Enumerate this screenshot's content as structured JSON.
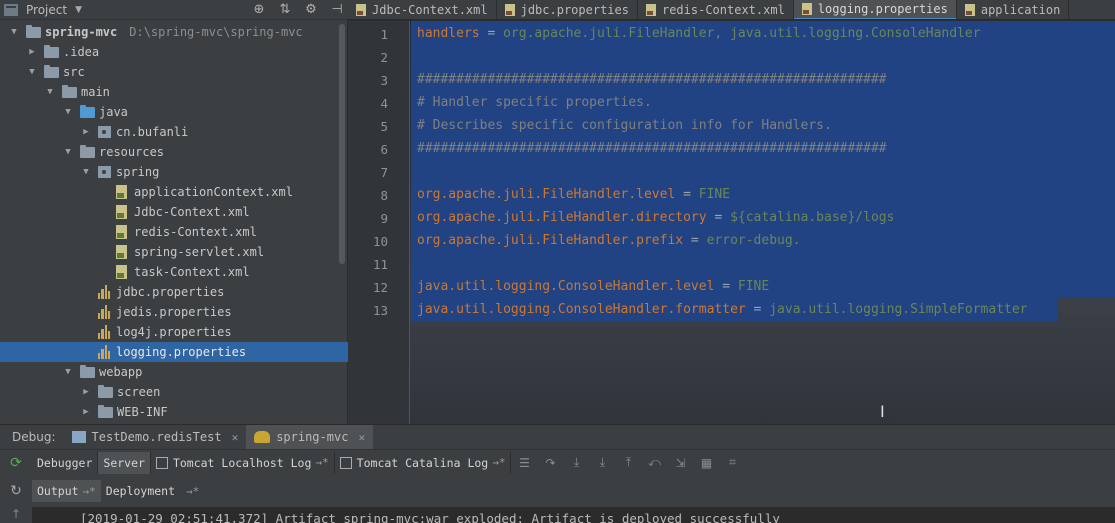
{
  "project_panel": {
    "title": "Project",
    "tree": [
      {
        "label": "spring-mvc",
        "path": "D:\\spring-mvc\\spring-mvc",
        "type": "module",
        "depth": 0,
        "expanded": true
      },
      {
        "label": ".idea",
        "type": "folder",
        "depth": 1,
        "expanded": false
      },
      {
        "label": "src",
        "type": "folder",
        "depth": 1,
        "expanded": true
      },
      {
        "label": "main",
        "type": "folder",
        "depth": 2,
        "expanded": true
      },
      {
        "label": "java",
        "type": "source-folder",
        "depth": 3,
        "expanded": true
      },
      {
        "label": "cn.bufanli",
        "type": "package",
        "depth": 4,
        "expanded": false
      },
      {
        "label": "resources",
        "type": "resource-folder",
        "depth": 3,
        "expanded": true
      },
      {
        "label": "spring",
        "type": "package",
        "depth": 4,
        "expanded": true
      },
      {
        "label": "applicationContext.xml",
        "type": "xml",
        "depth": 5
      },
      {
        "label": "Jdbc-Context.xml",
        "type": "xml",
        "depth": 5
      },
      {
        "label": "redis-Context.xml",
        "type": "xml",
        "depth": 5
      },
      {
        "label": "spring-servlet.xml",
        "type": "xml",
        "depth": 5
      },
      {
        "label": "task-Context.xml",
        "type": "xml",
        "depth": 5
      },
      {
        "label": "jdbc.properties",
        "type": "properties",
        "depth": 4
      },
      {
        "label": "jedis.properties",
        "type": "properties",
        "depth": 4
      },
      {
        "label": "log4j.properties",
        "type": "properties",
        "depth": 4
      },
      {
        "label": "logging.properties",
        "type": "properties",
        "depth": 4,
        "selected": true
      },
      {
        "label": "webapp",
        "type": "folder",
        "depth": 3,
        "expanded": true
      },
      {
        "label": "screen",
        "type": "folder",
        "depth": 4,
        "expanded": false
      },
      {
        "label": "WEB-INF",
        "type": "folder",
        "depth": 4,
        "expanded": false
      }
    ]
  },
  "editor_tabs": [
    {
      "label": "Jdbc-Context.xml",
      "active": false
    },
    {
      "label": "jdbc.properties",
      "active": false
    },
    {
      "label": "redis-Context.xml",
      "active": false
    },
    {
      "label": "logging.properties",
      "active": true
    },
    {
      "label": "application",
      "active": false
    }
  ],
  "editor": {
    "lines": [
      {
        "n": "1",
        "key": "handlers",
        "eq": " = ",
        "val": "org.apache.juli.FileHandler, java.util.logging.ConsoleHandler",
        "comment": ""
      },
      {
        "n": "2",
        "key": "",
        "eq": "",
        "val": "",
        "comment": ""
      },
      {
        "n": "3",
        "key": "",
        "eq": "",
        "val": "",
        "comment": "############################################################"
      },
      {
        "n": "4",
        "key": "",
        "eq": "",
        "val": "",
        "comment": "# Handler specific properties."
      },
      {
        "n": "5",
        "key": "",
        "eq": "",
        "val": "",
        "comment": "# Describes specific configuration info for Handlers."
      },
      {
        "n": "6",
        "key": "",
        "eq": "",
        "val": "",
        "comment": "############################################################"
      },
      {
        "n": "7",
        "key": "",
        "eq": "",
        "val": "",
        "comment": ""
      },
      {
        "n": "8",
        "key": "org.apache.juli.FileHandler.level",
        "eq": " = ",
        "val": "FINE",
        "comment": ""
      },
      {
        "n": "9",
        "key": "org.apache.juli.FileHandler.directory",
        "eq": " = ",
        "val": "${catalina.base}/logs",
        "comment": ""
      },
      {
        "n": "10",
        "key": "org.apache.juli.FileHandler.prefix",
        "eq": " = ",
        "val": "error-debug.",
        "comment": ""
      },
      {
        "n": "11",
        "key": "",
        "eq": "",
        "val": "",
        "comment": ""
      },
      {
        "n": "12",
        "key": "java.util.logging.ConsoleHandler.level",
        "eq": " = ",
        "val": "FINE",
        "comment": ""
      },
      {
        "n": "13",
        "key": "java.util.logging.ConsoleHandler.formatter",
        "eq": " = ",
        "val": "java.util.logging.SimpleFormatter",
        "comment": ""
      }
    ]
  },
  "debug": {
    "label": "Debug:",
    "tabs": [
      {
        "label": "TestDemo.redisTest",
        "active": false
      },
      {
        "label": "spring-mvc",
        "active": true
      }
    ],
    "toolbar": {
      "debugger_label": "Debugger",
      "server_label": "Server",
      "localhost_log_label": "Tomcat Localhost Log",
      "catalina_log_label": "Tomcat Catalina Log",
      "arrows": "→*"
    },
    "subtabs": {
      "output_label": "Output",
      "deployment_label": "Deployment",
      "arrows": "→*"
    },
    "console_line": "[2019-01-29 02:51:41,372] Artifact spring-mvc:war exploded: Artifact is deployed successfully"
  }
}
